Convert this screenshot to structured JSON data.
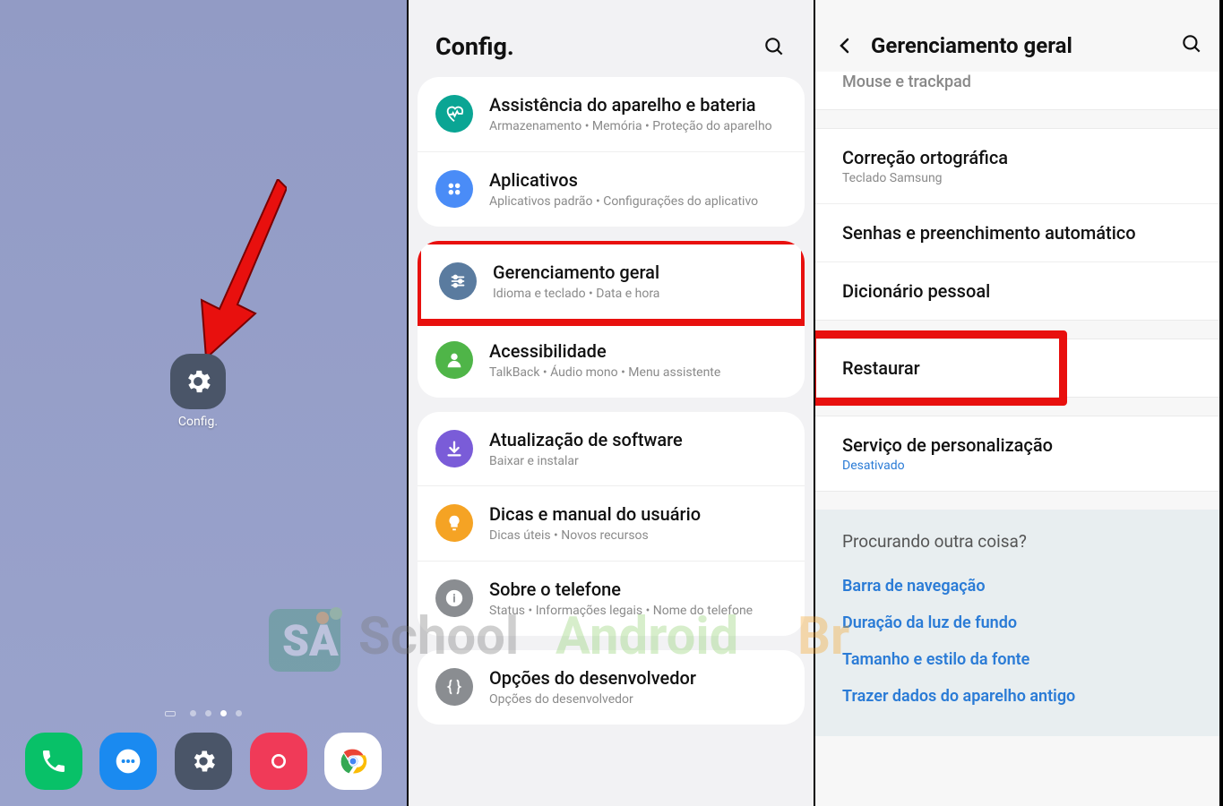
{
  "home": {
    "config_label": "Config.",
    "dock": [
      "phone",
      "messages",
      "settings",
      "camera",
      "chrome"
    ]
  },
  "settings": {
    "header_title": "Config.",
    "groups": [
      {
        "items": [
          {
            "icon": "ic-teal",
            "shape": "heartbeat",
            "title": "Assistência do aparelho e bateria",
            "sub": "Armazenamento  •  Memória  •  Proteção do aparelho"
          },
          {
            "icon": "ic-blue",
            "shape": "grid4",
            "title": "Aplicativos",
            "sub": "Aplicativos padrão  •  Configurações do aplicativo"
          }
        ]
      },
      {
        "items": [
          {
            "icon": "ic-bluegray",
            "shape": "sliders",
            "title": "Gerenciamento geral",
            "sub": "Idioma e teclado  •  Data e hora",
            "highlight": true
          },
          {
            "icon": "ic-green",
            "shape": "person",
            "title": "Acessibilidade",
            "sub": "TalkBack  •  Áudio mono  •  Menu assistente"
          }
        ]
      },
      {
        "items": [
          {
            "icon": "ic-purple",
            "shape": "download",
            "title": "Atualização de software",
            "sub": "Baixar e instalar"
          },
          {
            "icon": "ic-orange",
            "shape": "bulb",
            "title": "Dicas e manual do usuário",
            "sub": "Dicas úteis  •  Novos recursos"
          },
          {
            "icon": "ic-gray",
            "shape": "info",
            "title": "Sobre o telefone",
            "sub": "Status  •  Informações legais  •  Nome do telefone"
          }
        ]
      },
      {
        "items": [
          {
            "icon": "ic-gray",
            "shape": "braces",
            "title": "Opções do desenvolvedor",
            "sub": "Opções do desenvolvedor"
          }
        ]
      }
    ]
  },
  "gm": {
    "header_title": "Gerenciamento geral",
    "truncated_top": "Mouse e trackpad",
    "groups": [
      {
        "items": [
          {
            "title": "Correção ortográfica",
            "sub": "Teclado Samsung"
          },
          {
            "title": "Senhas e preenchimento automático"
          },
          {
            "title": "Dicionário pessoal"
          }
        ]
      },
      {
        "items": [
          {
            "title": "Restaurar",
            "highlight": true
          }
        ]
      },
      {
        "items": [
          {
            "title": "Serviço de personalização",
            "sub": "Desativado",
            "link": true
          }
        ]
      }
    ],
    "footer": {
      "heading": "Procurando outra coisa?",
      "links": [
        "Barra de navegação",
        "Duração da luz de fundo",
        "Tamanho e estilo da fonte",
        "Trazer dados do aparelho antigo"
      ]
    }
  }
}
